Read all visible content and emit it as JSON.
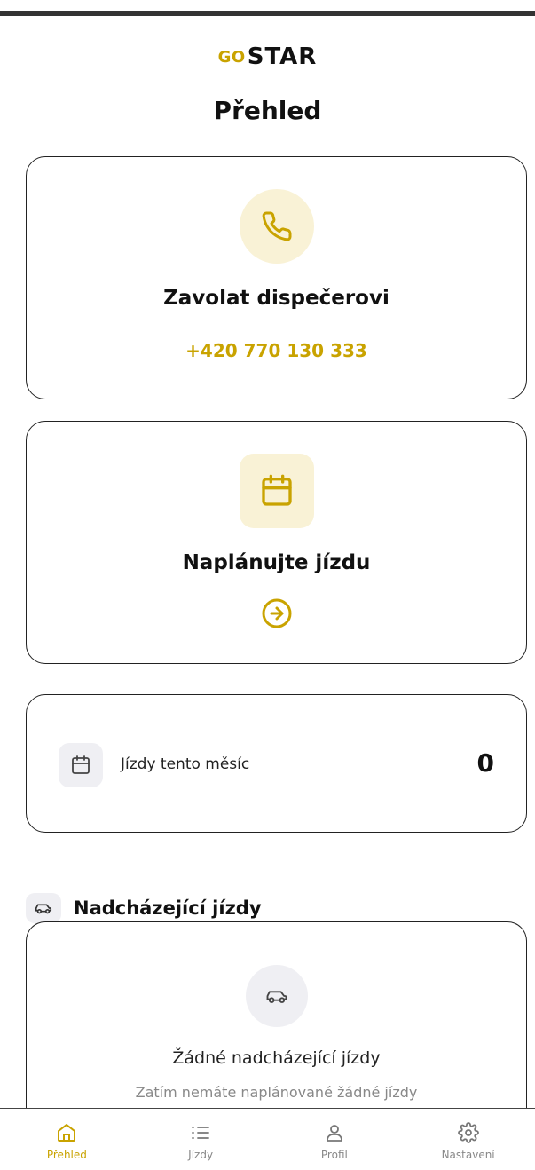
{
  "brand": {
    "logo_prefix": "GO",
    "logo_main": "STAR",
    "accent_color": "#c9a300"
  },
  "page": {
    "title": "Přehled"
  },
  "call_card": {
    "icon": "phone-icon",
    "title": "Zavolat dispečerovi",
    "phone": "+420 770 130 333"
  },
  "plan_card": {
    "icon": "calendar-icon",
    "title": "Naplánujte jízdu",
    "action_icon": "arrow-right-circle-icon"
  },
  "stats_card": {
    "icon": "calendar-icon",
    "label": "Jízdy tento měsíc",
    "value": "0"
  },
  "upcoming": {
    "icon": "car-icon",
    "title": "Nadcházející jízdy",
    "empty_icon": "car-icon",
    "empty_title": "Žádné nadcházející jízdy",
    "empty_subtitle": "Zatím nemáte naplánované žádné jízdy"
  },
  "bottom_nav": {
    "items": [
      {
        "label": "Přehled",
        "icon": "home-icon",
        "active": true
      },
      {
        "label": "Jízdy",
        "icon": "list-icon",
        "active": false
      },
      {
        "label": "Profil",
        "icon": "user-icon",
        "active": false
      },
      {
        "label": "Nastavení",
        "icon": "gear-icon",
        "active": false
      }
    ]
  }
}
